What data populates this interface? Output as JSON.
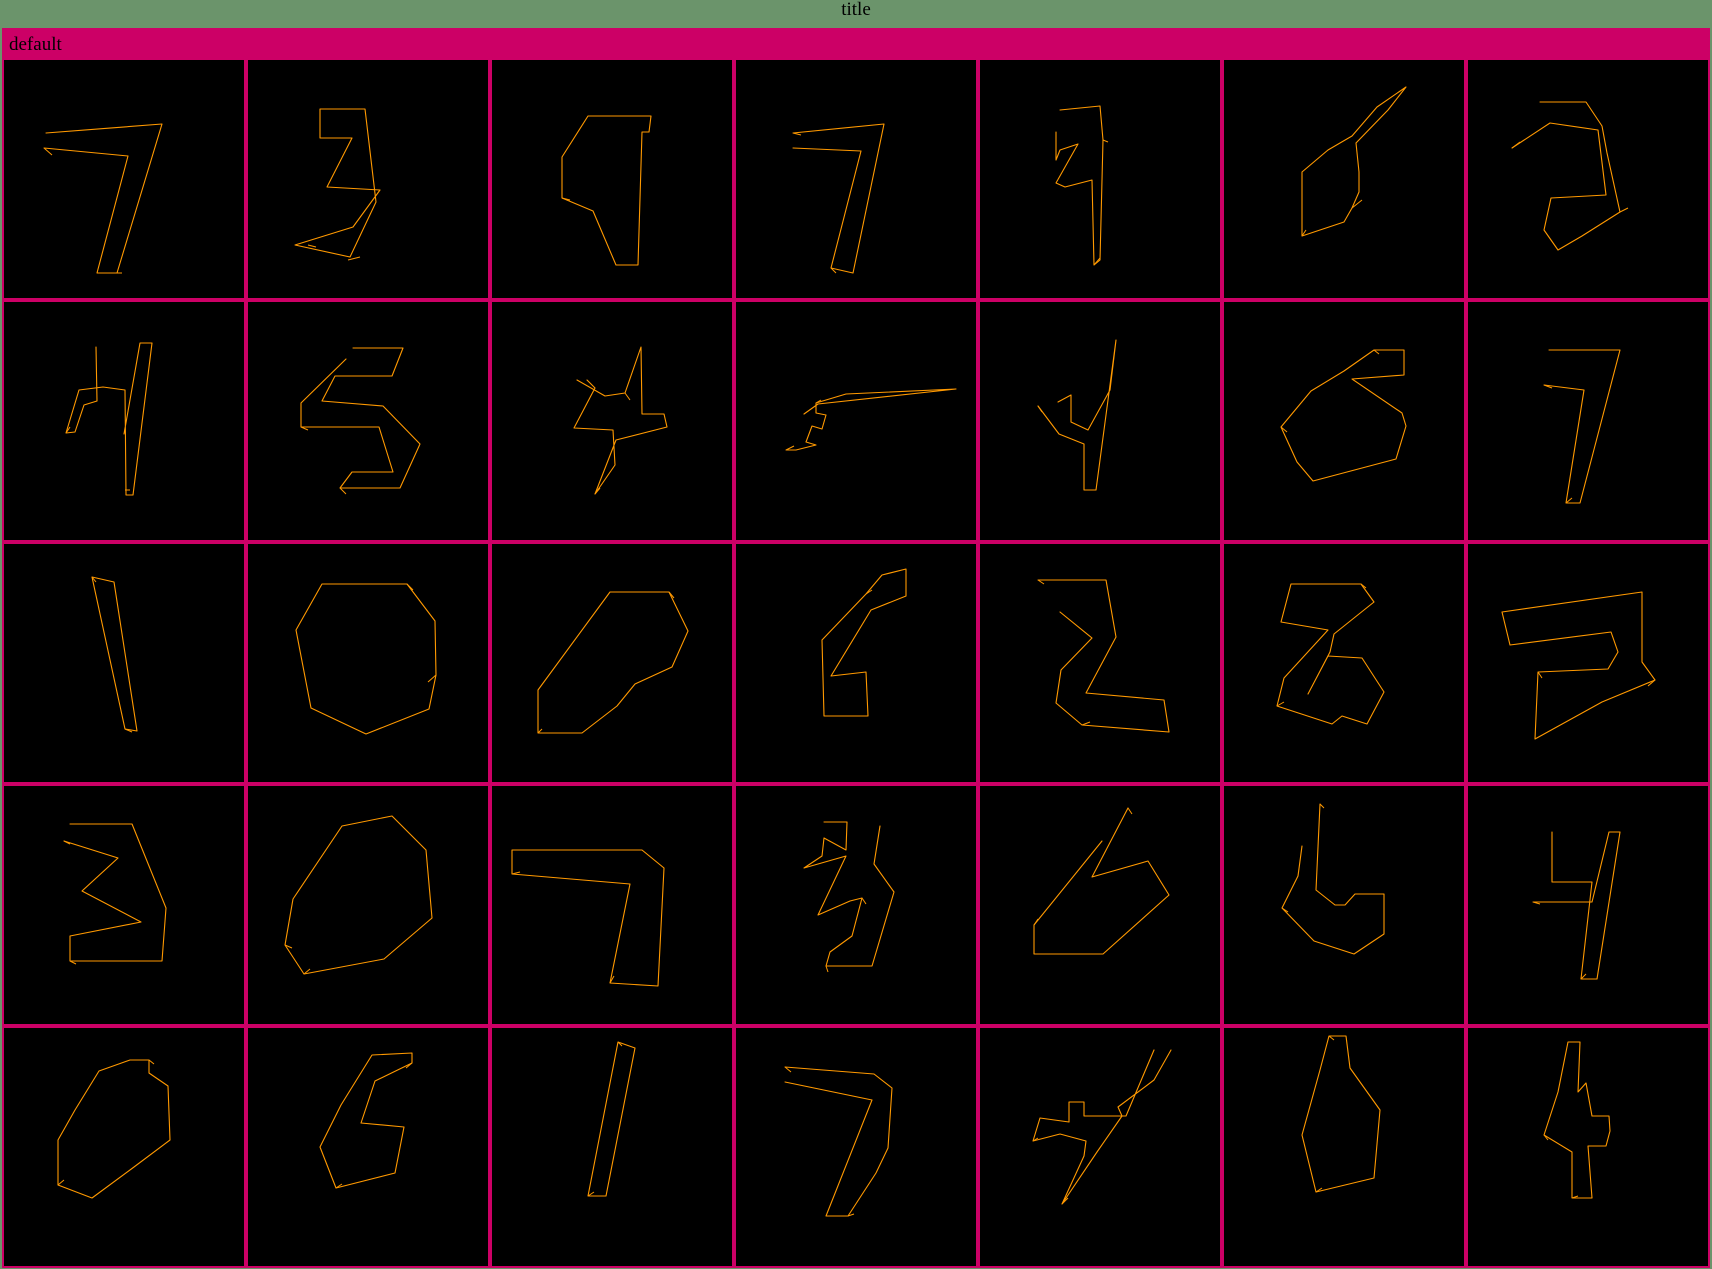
{
  "window": {
    "title": "title"
  },
  "panel": {
    "header": "default"
  },
  "colors": {
    "titlebar": "#6b946b",
    "panel_border": "#cc0066",
    "cell_background": "#000000",
    "stroke": "#ff9900"
  },
  "grid": {
    "rows": 5,
    "columns": 7
  }
}
